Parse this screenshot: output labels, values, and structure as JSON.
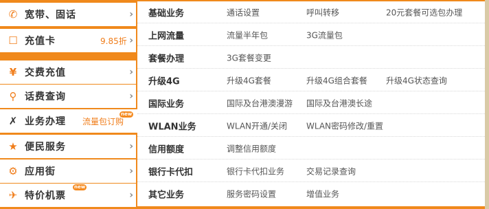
{
  "menu": {
    "items": [
      {
        "icon": "phone-icon",
        "label": "宽带、固话",
        "extra": "",
        "sub": ""
      },
      {
        "icon": "card-icon",
        "label": "充值卡",
        "extra": "9.85折",
        "sub": ""
      },
      {
        "icon": "yen-icon",
        "label": "交费充值",
        "extra": "",
        "sub": ""
      },
      {
        "icon": "search-icon",
        "label": "话费查询",
        "extra": "",
        "sub": ""
      },
      {
        "icon": "tools-icon",
        "label": "业务办理",
        "extra": "",
        "sub": "流量包订购",
        "badge": "new"
      },
      {
        "icon": "people-icon",
        "label": "便民服务",
        "extra": "",
        "sub": ""
      },
      {
        "icon": "android-icon",
        "label": "应用街",
        "extra": "",
        "sub": ""
      },
      {
        "icon": "plane-icon",
        "label": "特价机票",
        "extra": "",
        "sub": "",
        "badge": "new"
      }
    ]
  },
  "panel": {
    "rows": [
      {
        "category": "基础业务",
        "links": [
          "通话设置",
          "呼叫转移",
          "20元套餐可选包办理"
        ]
      },
      {
        "category": "上网流量",
        "links": [
          "流量半年包",
          "3G流量包"
        ]
      },
      {
        "category": "套餐办理",
        "links": [
          "3G套餐变更"
        ]
      },
      {
        "category": "升级4G",
        "links": [
          "升级4G套餐",
          "升级4G组合套餐",
          "升级4G状态查询"
        ]
      },
      {
        "category": "国际业务",
        "links": [
          "国际及台港澳漫游",
          "国际及台港澳长途"
        ]
      },
      {
        "category": "WLAN业务",
        "links": [
          "WLAN开通/关闭",
          "WLAN密码修改/重置"
        ]
      },
      {
        "category": "信用额度",
        "links": [
          "调整信用额度"
        ]
      },
      {
        "category": "银行卡代扣",
        "links": [
          "银行卡代扣业务",
          "交易记录查询"
        ]
      },
      {
        "category": "其它业务",
        "links": [
          "服务密码设置",
          "增值业务"
        ]
      }
    ]
  },
  "colors": {
    "accent": "#f0891c",
    "link": "#555555",
    "sub": "#f07d1a"
  }
}
